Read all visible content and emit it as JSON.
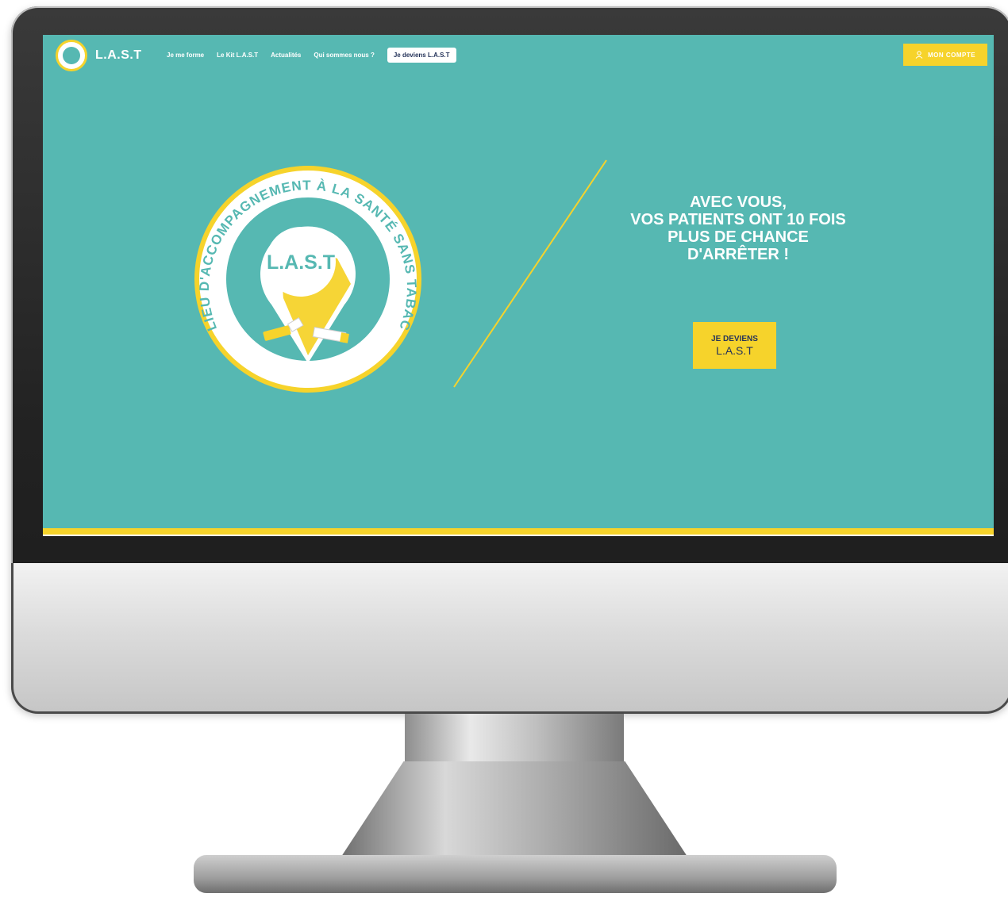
{
  "brand": {
    "name": "L.A.S.T"
  },
  "nav": {
    "links": [
      "Je me forme",
      "Le Kit L.A.S.T",
      "Actualités",
      "Qui sommes nous ?"
    ],
    "cta": "Je deviens L.A.S.T",
    "account": "MON COMPTE"
  },
  "hero": {
    "emblem_ring_text": "LIEU D'ACCOMPAGNEMENT À LA SANTÉ SANS TABAC",
    "emblem_center": "L.A.S.T",
    "title_lines": [
      "AVEC VOUS,",
      "VOS PATIENTS ONT 10 FOIS",
      "PLUS DE CHANCE",
      "D'ARRÊTER !"
    ],
    "cta_line1": "JE DEVIENS",
    "cta_line2": "L.A.S.T"
  },
  "colors": {
    "teal": "#56b8b2",
    "yellow": "#f6d32b",
    "navy": "#25335a",
    "white": "#ffffff"
  },
  "icons": {
    "account": "user-icon"
  }
}
